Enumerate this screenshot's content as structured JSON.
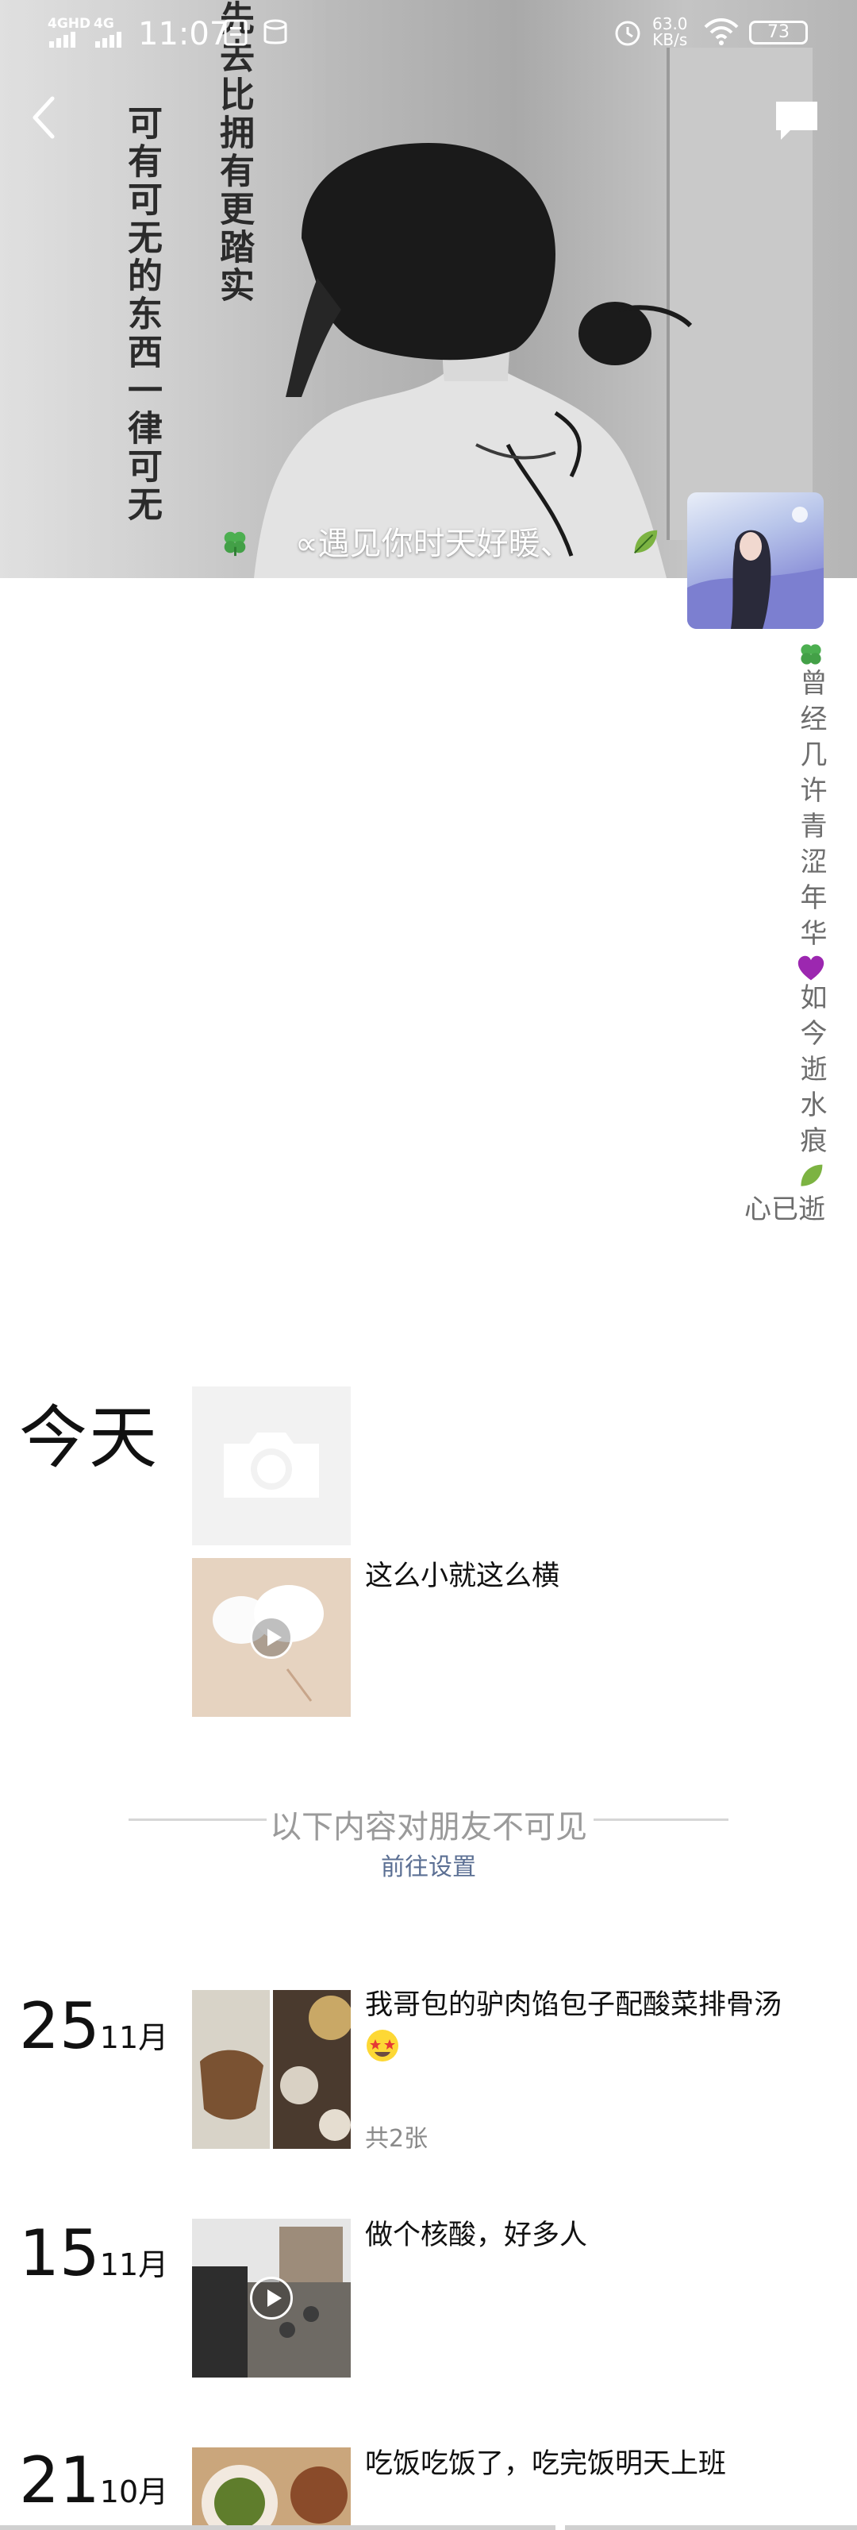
{
  "status_bar": {
    "network_1": "4GHD",
    "network_2": "4G",
    "time": "11:07",
    "speed_value": "63.0",
    "speed_unit": "KB/s",
    "battery": "73"
  },
  "header": {
    "back_icon": "chevron-left-icon",
    "comment_icon": "comment-bubble-icon"
  },
  "cover": {
    "vertical_text_right": "先去比拥有更踏实",
    "vertical_text_left": "可有可无的东西一律可无",
    "caption": "∝遇见你时天好暖、"
  },
  "profile": {
    "signature_columns": [
      "曾经几许青涩年华",
      "如今逝水痕"
    ],
    "signature_last_line": "心已逝"
  },
  "feed": {
    "today_label": "今天",
    "today_post_text": "这么小就这么横",
    "divider_text": "以下内容对朋友不可见",
    "settings_link": "前往设置",
    "posts": [
      {
        "day": "25",
        "month": "11月",
        "text": "我哥包的驴肉馅包子配酸菜排骨汤",
        "count": "共2张"
      },
      {
        "day": "15",
        "month": "11月",
        "text": "做个核酸，好多人"
      },
      {
        "day": "21",
        "month": "10月",
        "text": "吃饭吃饭了，吃完饭明天上班"
      }
    ]
  },
  "colors": {
    "link": "#5b6f93",
    "muted": "#9a9a9a",
    "signature": "#6d6d6d"
  }
}
